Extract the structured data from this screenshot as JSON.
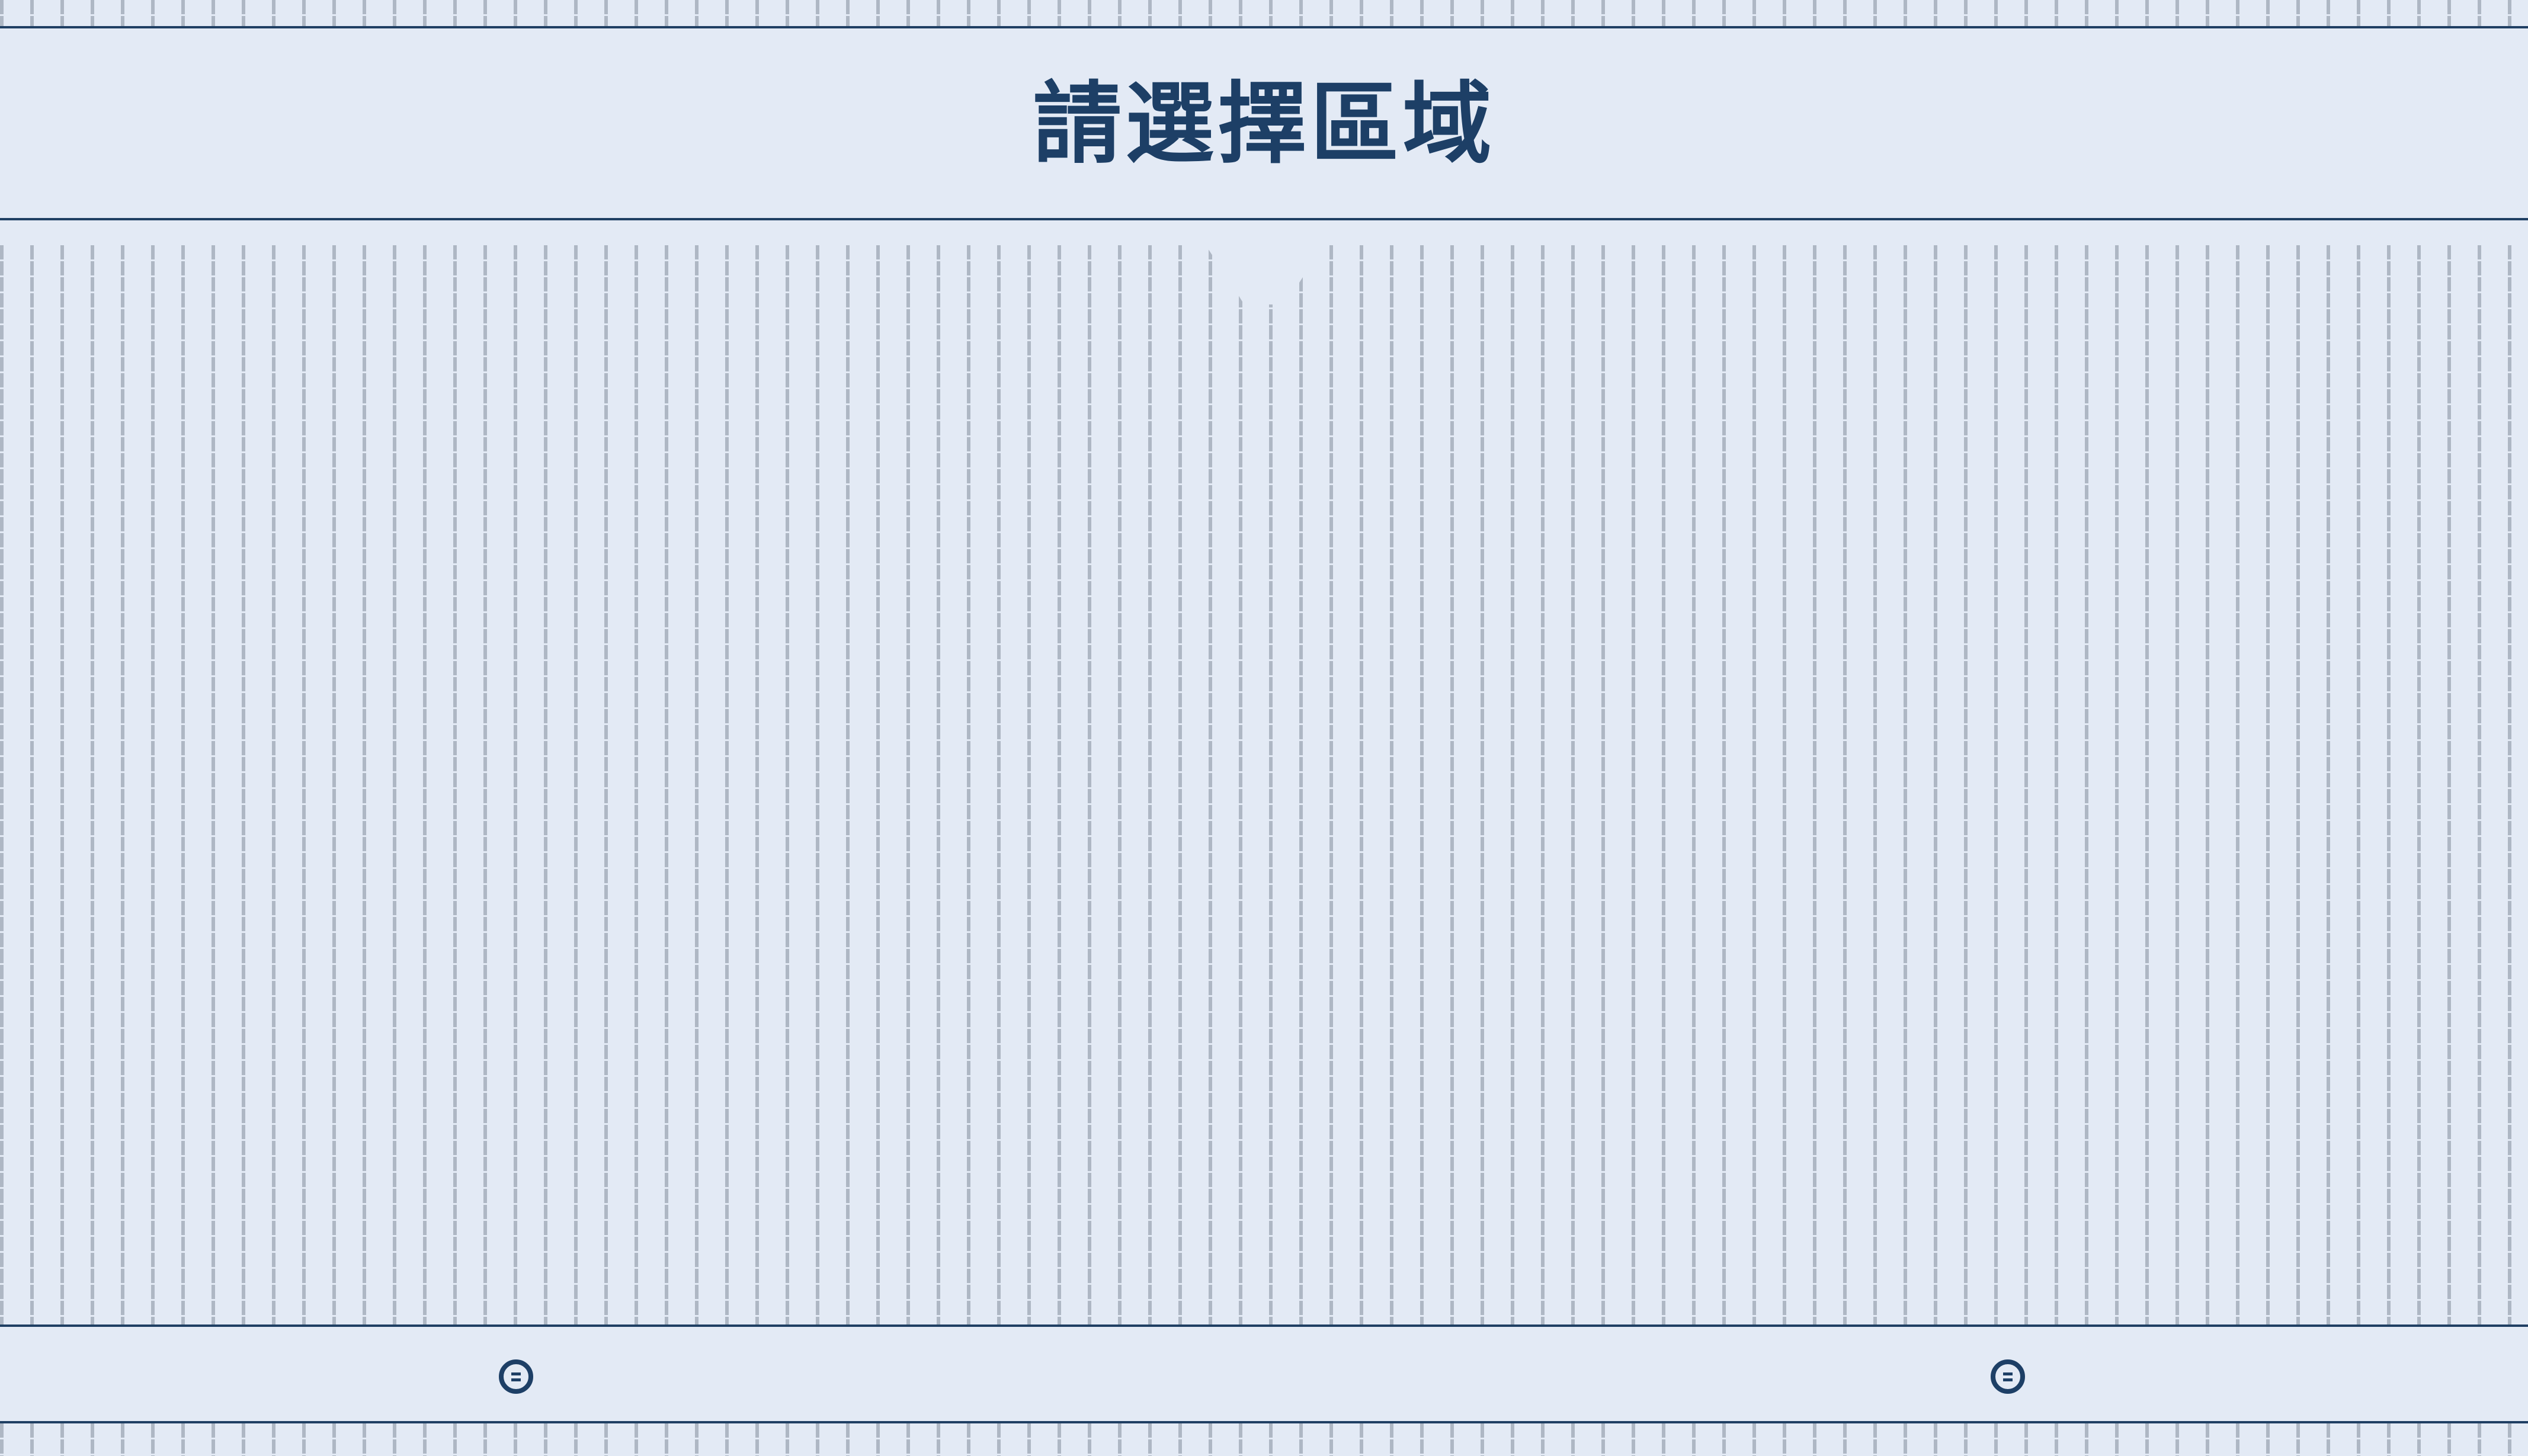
{
  "header": {
    "title": "請選擇區域"
  },
  "footer": {
    "left_button_icon": "dial-icon",
    "right_button_icon": "dial-icon"
  },
  "colors": {
    "background": "#e3eaf5",
    "accent": "#1d3f66",
    "grid": "#aeb7c4"
  }
}
